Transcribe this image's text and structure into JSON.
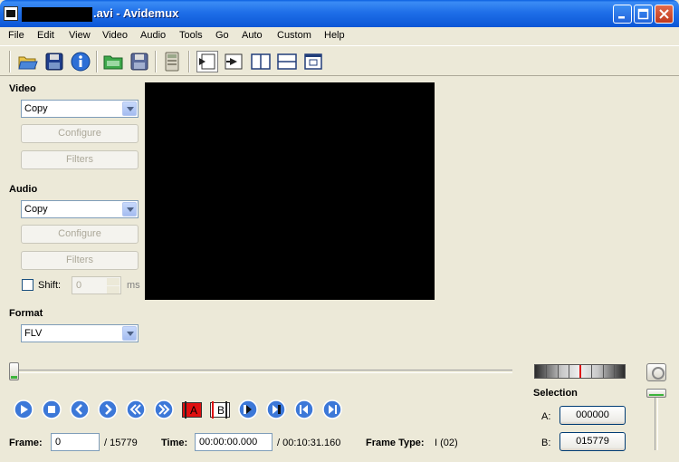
{
  "window": {
    "title": ".avi - Avidemux"
  },
  "menu": [
    "File",
    "Edit",
    "View",
    "Video",
    "Audio",
    "Tools",
    "Go",
    "Auto",
    "Custom",
    "Help"
  ],
  "toolbar": {
    "icons": [
      "open-icon",
      "save-icon",
      "info-icon",
      "open-folder-icon",
      "save-as-icon",
      "calculator-icon",
      "output-mode-icon",
      "input-mode-icon",
      "side-by-side-icon",
      "top-bottom-icon",
      "preview-icon"
    ]
  },
  "video": {
    "label": "Video",
    "codec": "Copy",
    "configure_label": "Configure",
    "filters_label": "Filters"
  },
  "audio": {
    "label": "Audio",
    "codec": "Copy",
    "configure_label": "Configure",
    "filters_label": "Filters",
    "shift_label": "Shift:",
    "shift_value": "0",
    "shift_unit": "ms"
  },
  "format": {
    "label": "Format",
    "value": "FLV"
  },
  "selection": {
    "label": "Selection",
    "a_label": "A:",
    "a_value": "000000",
    "b_label": "B:",
    "b_value": "015779"
  },
  "status": {
    "frame_label": "Frame:",
    "frame_value": "0",
    "frame_total": "/ 15779",
    "time_label": "Time:",
    "time_value": "00:00:00.000",
    "time_total": "/ 00:10:31.160",
    "frame_type_label": "Frame Type:",
    "frame_type_value": "I (02)"
  },
  "markers": {
    "a": "A",
    "b": "B"
  },
  "colors": {
    "title_bar": "#0B56D6",
    "nav_button": "#3C78D8",
    "marker_red": "#E01010"
  }
}
